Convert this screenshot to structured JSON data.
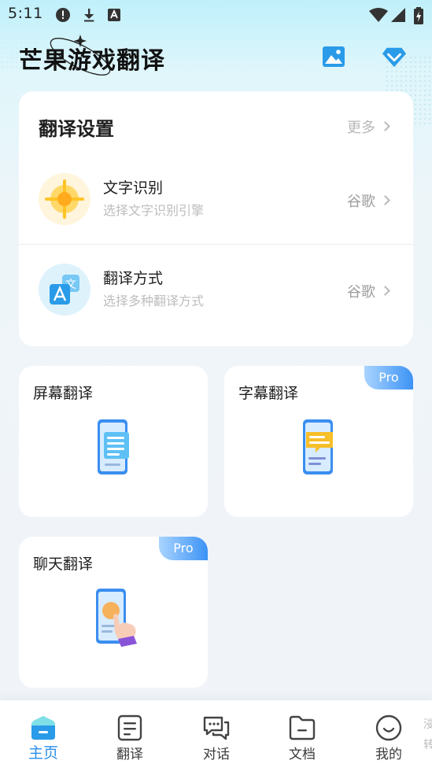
{
  "status_bar": {
    "time": "5:11"
  },
  "header": {
    "app_title": "芒果游戏翻译"
  },
  "settings": {
    "title": "翻译设置",
    "more_label": "更多",
    "rows": [
      {
        "title": "文字识别",
        "subtitle": "选择文字识别引擎",
        "value": "谷歌"
      },
      {
        "title": "翻译方式",
        "subtitle": "选择多种翻译方式",
        "value": "谷歌"
      }
    ]
  },
  "features": [
    {
      "title": "屏幕翻译",
      "badge": ""
    },
    {
      "title": "字幕翻译",
      "badge": "Pro"
    },
    {
      "title": "聊天翻译",
      "badge": "Pro"
    }
  ],
  "bottom_nav": {
    "items": [
      {
        "label": "主页",
        "icon": "home-icon",
        "active": true
      },
      {
        "label": "翻译",
        "icon": "translate-doc-icon",
        "active": false
      },
      {
        "label": "对话",
        "icon": "chat-icon",
        "active": false
      },
      {
        "label": "文档",
        "icon": "folder-icon",
        "active": false
      },
      {
        "label": "我的",
        "icon": "smile-icon",
        "active": false
      }
    ],
    "edge_text": [
      "浸",
      "转"
    ]
  },
  "colors": {
    "accent": "#2a8fe8",
    "pro_gradient_start": "#a9d4ff",
    "pro_gradient_end": "#3c93f5"
  }
}
